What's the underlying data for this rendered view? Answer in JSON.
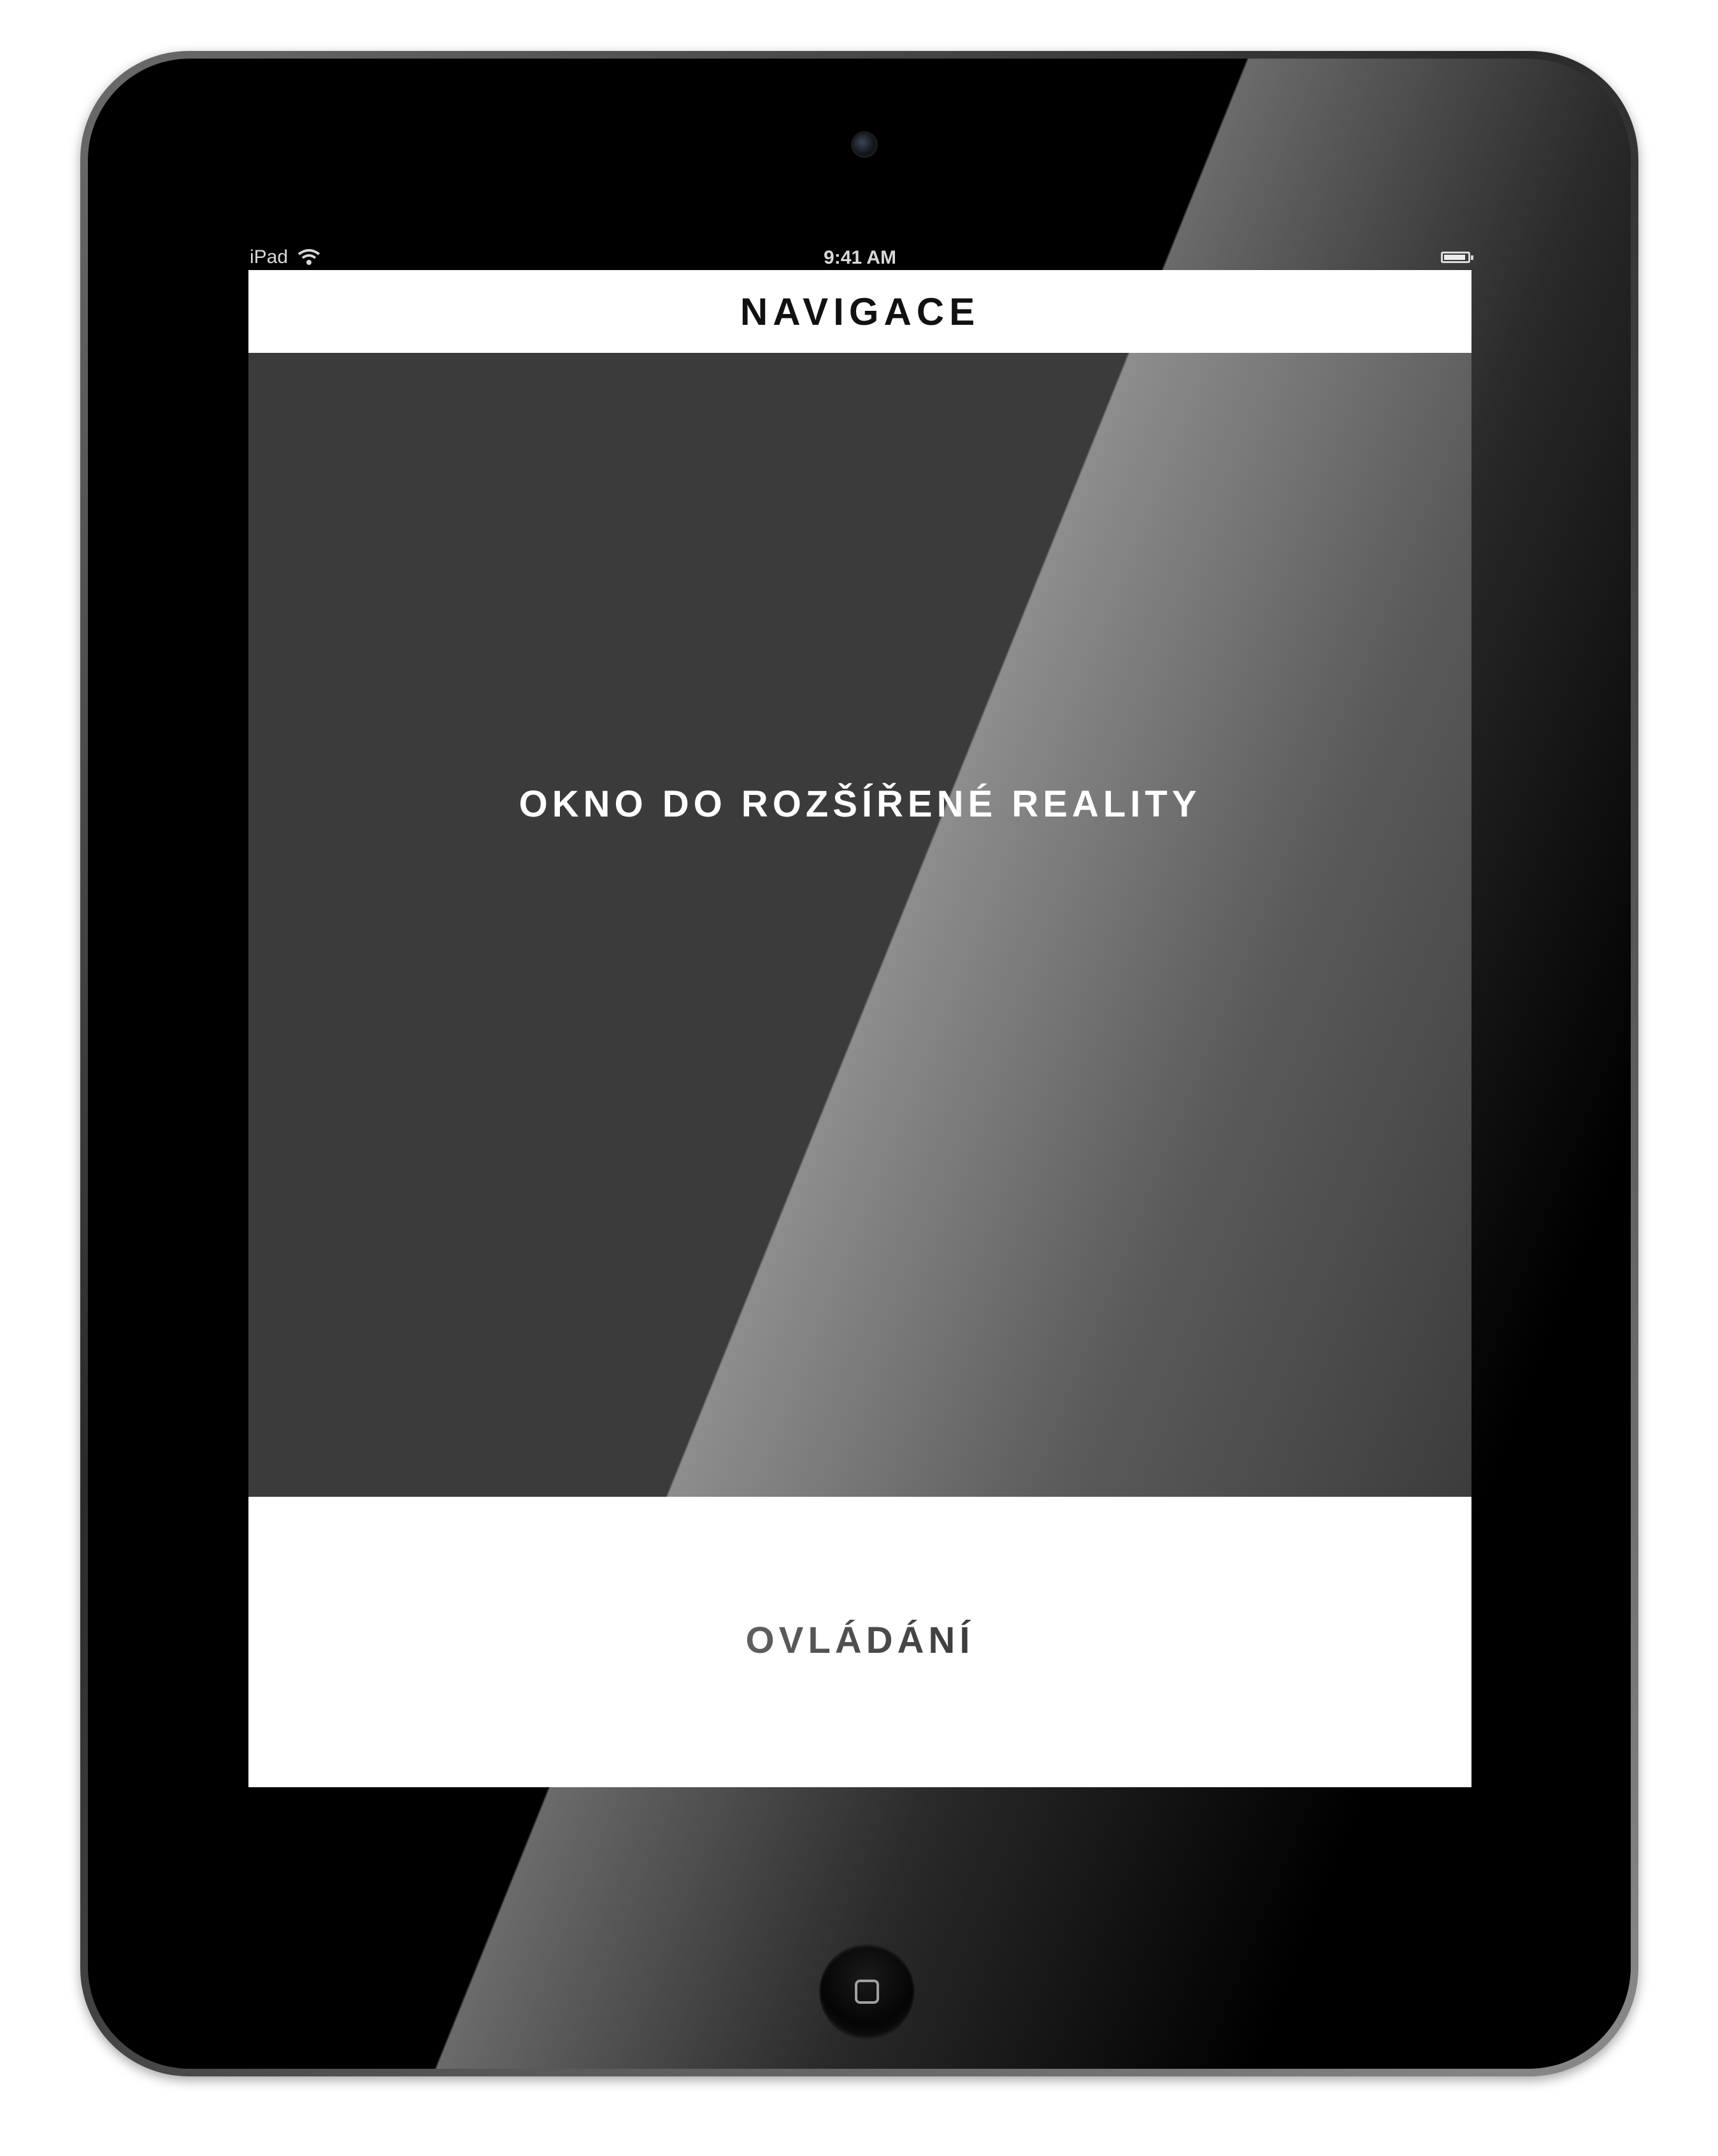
{
  "status_bar": {
    "device_label": "iPad",
    "time": "9:41 AM"
  },
  "nav_bar": {
    "title": "NAVIGACE"
  },
  "main": {
    "ar_window_label": "OKNO DO ROZŠÍŘENÉ REALITY",
    "controls_label": "OVLÁDÁNÍ"
  },
  "icons": {
    "wifi": "wifi-icon",
    "battery": "battery-icon",
    "home": "home-button-icon"
  },
  "battery_level": 0.92,
  "colors": {
    "ar_background": "#3b3b3b",
    "nav_background": "#ffffff",
    "device_bezel": "#000000"
  }
}
